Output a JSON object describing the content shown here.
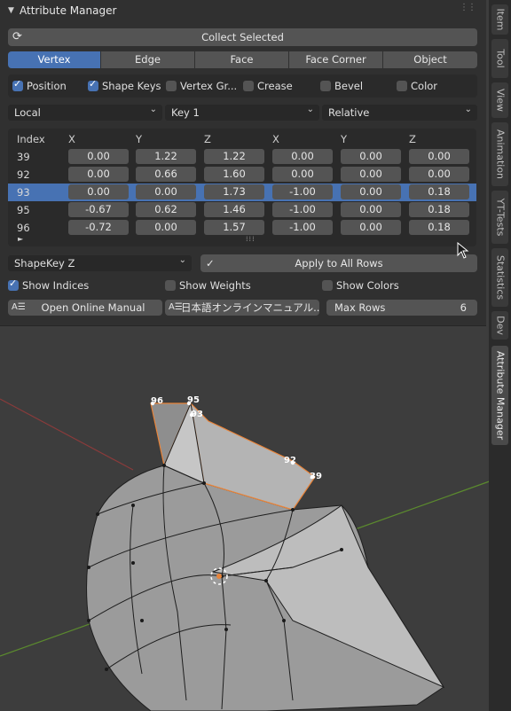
{
  "panel": {
    "title": "Attribute Manager",
    "collect_button": "Collect Selected",
    "domain_tabs": [
      "Vertex",
      "Edge",
      "Face",
      "Face Corner",
      "Object"
    ],
    "active_domain": "Vertex",
    "attribute_toggles": [
      {
        "label": "Position",
        "checked": true
      },
      {
        "label": "Shape Keys",
        "checked": true
      },
      {
        "label": "Vertex Gr...",
        "checked": false
      },
      {
        "label": "Crease",
        "checked": false
      },
      {
        "label": "Bevel",
        "checked": false
      },
      {
        "label": "Color",
        "checked": false
      }
    ],
    "space_dropdown": "Local",
    "shapekey_dropdown": "Key 1",
    "mode_dropdown": "Relative",
    "table": {
      "headers": [
        "Index",
        "X",
        "Y",
        "Z",
        "X",
        "Y",
        "Z"
      ],
      "rows": [
        {
          "index": "39",
          "values": [
            "0.00",
            "1.22",
            "1.22",
            "0.00",
            "0.00",
            "0.00"
          ]
        },
        {
          "index": "92",
          "values": [
            "0.00",
            "0.66",
            "1.60",
            "0.00",
            "0.00",
            "0.00"
          ]
        },
        {
          "index": "93",
          "values": [
            "0.00",
            "0.00",
            "1.73",
            "-1.00",
            "0.00",
            "0.18"
          ]
        },
        {
          "index": "95",
          "values": [
            "-0.67",
            "0.62",
            "1.46",
            "-1.00",
            "0.00",
            "0.18"
          ]
        },
        {
          "index": "96",
          "values": [
            "-0.72",
            "0.00",
            "1.57",
            "-1.00",
            "0.00",
            "0.18"
          ]
        }
      ],
      "selected_index": "93"
    },
    "target_dropdown": "ShapeKey Z",
    "apply_button": "Apply to All Rows",
    "display_options": [
      {
        "label": "Show Indices",
        "checked": true
      },
      {
        "label": "Show Weights",
        "checked": false
      },
      {
        "label": "Show Colors",
        "checked": false
      }
    ],
    "manual_button": "Open Online Manual",
    "manual_jp_button": "日本語オンラインマニュアル...",
    "max_rows_label": "Max Rows",
    "max_rows_value": "6"
  },
  "side_tabs": [
    "Item",
    "Tool",
    "View",
    "Animation",
    "YT-Tests",
    "Statistics",
    "Dev",
    "Attribute Manager"
  ],
  "active_side_tab": "Attribute Manager",
  "viewport_labels": [
    "96",
    "95",
    "93",
    "92",
    "39"
  ],
  "colors": {
    "accent": "#4772b3",
    "selection_outline": "#e8843a"
  }
}
